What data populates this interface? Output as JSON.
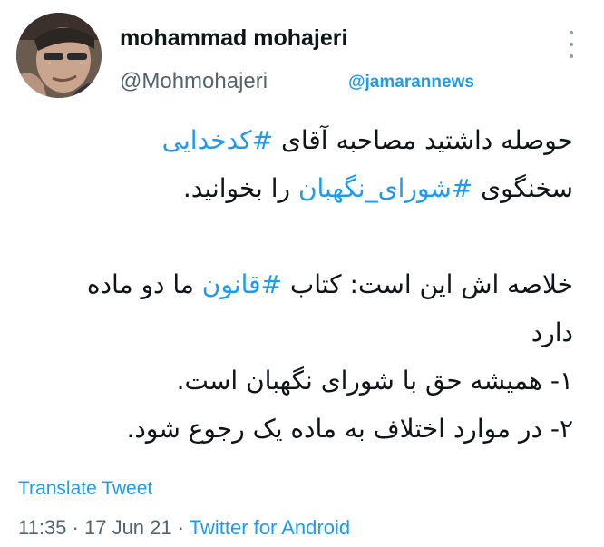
{
  "author": {
    "display_name": "mohammad mohajeri",
    "handle": "@Mohmohajeri",
    "avatar_icon": "profile-photo"
  },
  "watermark": "@jamarannews",
  "tweet": {
    "line1": {
      "text": "حوصله داشتید مصاحبه آقای ",
      "hashtag": "#کدخدایی"
    },
    "line2": {
      "text_before": "سخنگوی ",
      "hashtag": "#شورای_نگهبان",
      "text_after": " را بخوانید."
    },
    "line3": {
      "text_before": "خلاصه اش این است: کتاب ",
      "hashtag": "#قانون",
      "text_after": " ما دو ماده"
    },
    "line4": "دارد",
    "line5": "۱- همیشه حق با شورای نگهبان است.",
    "line6": "۲- در موارد اختلاف به ماده یک رجوع شود."
  },
  "translate_label": "Translate Tweet",
  "meta": {
    "time": "11:35",
    "separator": " · ",
    "date": "17 Jun 21",
    "source": "Twitter for Android"
  },
  "colors": {
    "link": "#1d9bf0",
    "secondary_text": "#536471",
    "primary_text": "#0f1419"
  }
}
